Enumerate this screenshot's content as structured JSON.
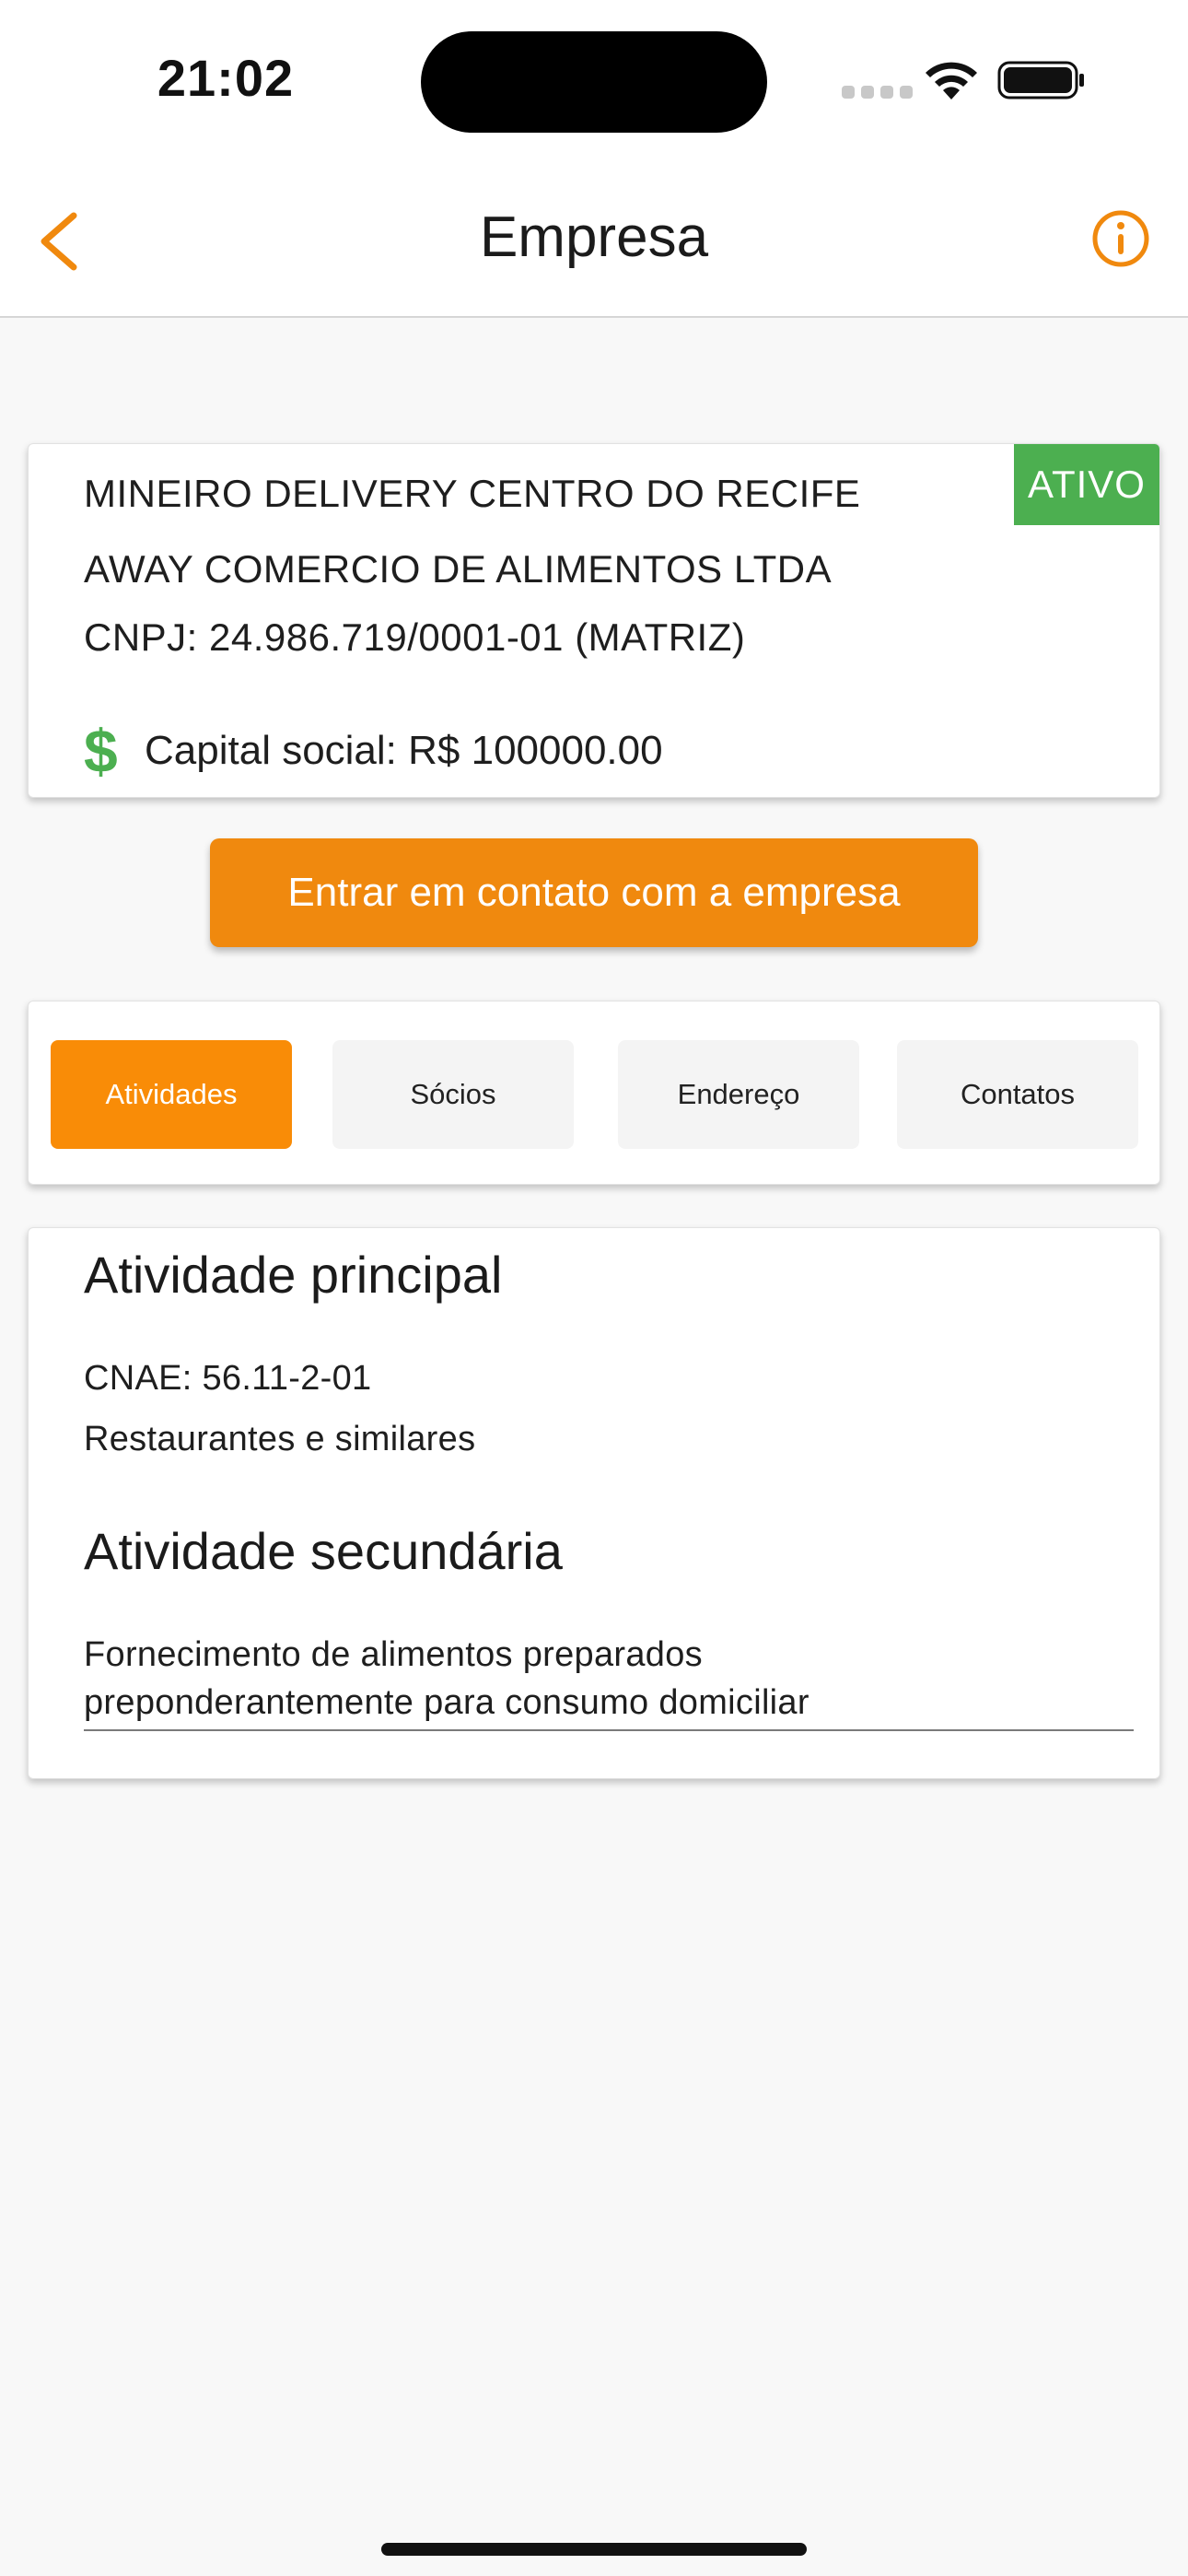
{
  "status_bar": {
    "time": "21:02",
    "wifi_icon": "wifi-icon",
    "battery_icon": "battery-icon"
  },
  "header": {
    "title": "Empresa",
    "back_icon": "chevron-left-icon",
    "info_icon": "info-icon"
  },
  "colors": {
    "accent": "#f0890e",
    "status_active": "#4caf50",
    "background": "#f8f8f8"
  },
  "company": {
    "status_badge": "ATIVO",
    "trade_name": "MINEIRO DELIVERY CENTRO DO RECIFE",
    "legal_name": "AWAY COMERCIO DE ALIMENTOS LTDA",
    "cnpj": "CNPJ: 24.986.719/0001-01 (MATRIZ)",
    "capital_icon": "$",
    "capital": "Capital social: R$ 100000.00"
  },
  "contact_button": {
    "label": "Entrar em contato com a empresa"
  },
  "tabs": [
    {
      "label": "Atividades",
      "active": true
    },
    {
      "label": "Sócios",
      "active": false
    },
    {
      "label": "Endereço",
      "active": false
    },
    {
      "label": "Contatos",
      "active": false
    }
  ],
  "activities": {
    "primary_heading": "Atividade principal",
    "primary_cnae": "CNAE: 56.11-2-01",
    "primary_description": "Restaurantes e similares",
    "secondary_heading": "Atividade secundária",
    "secondary_lines": [
      "Fornecimento de alimentos preparados",
      "preponderantemente para consumo domiciliar"
    ]
  }
}
